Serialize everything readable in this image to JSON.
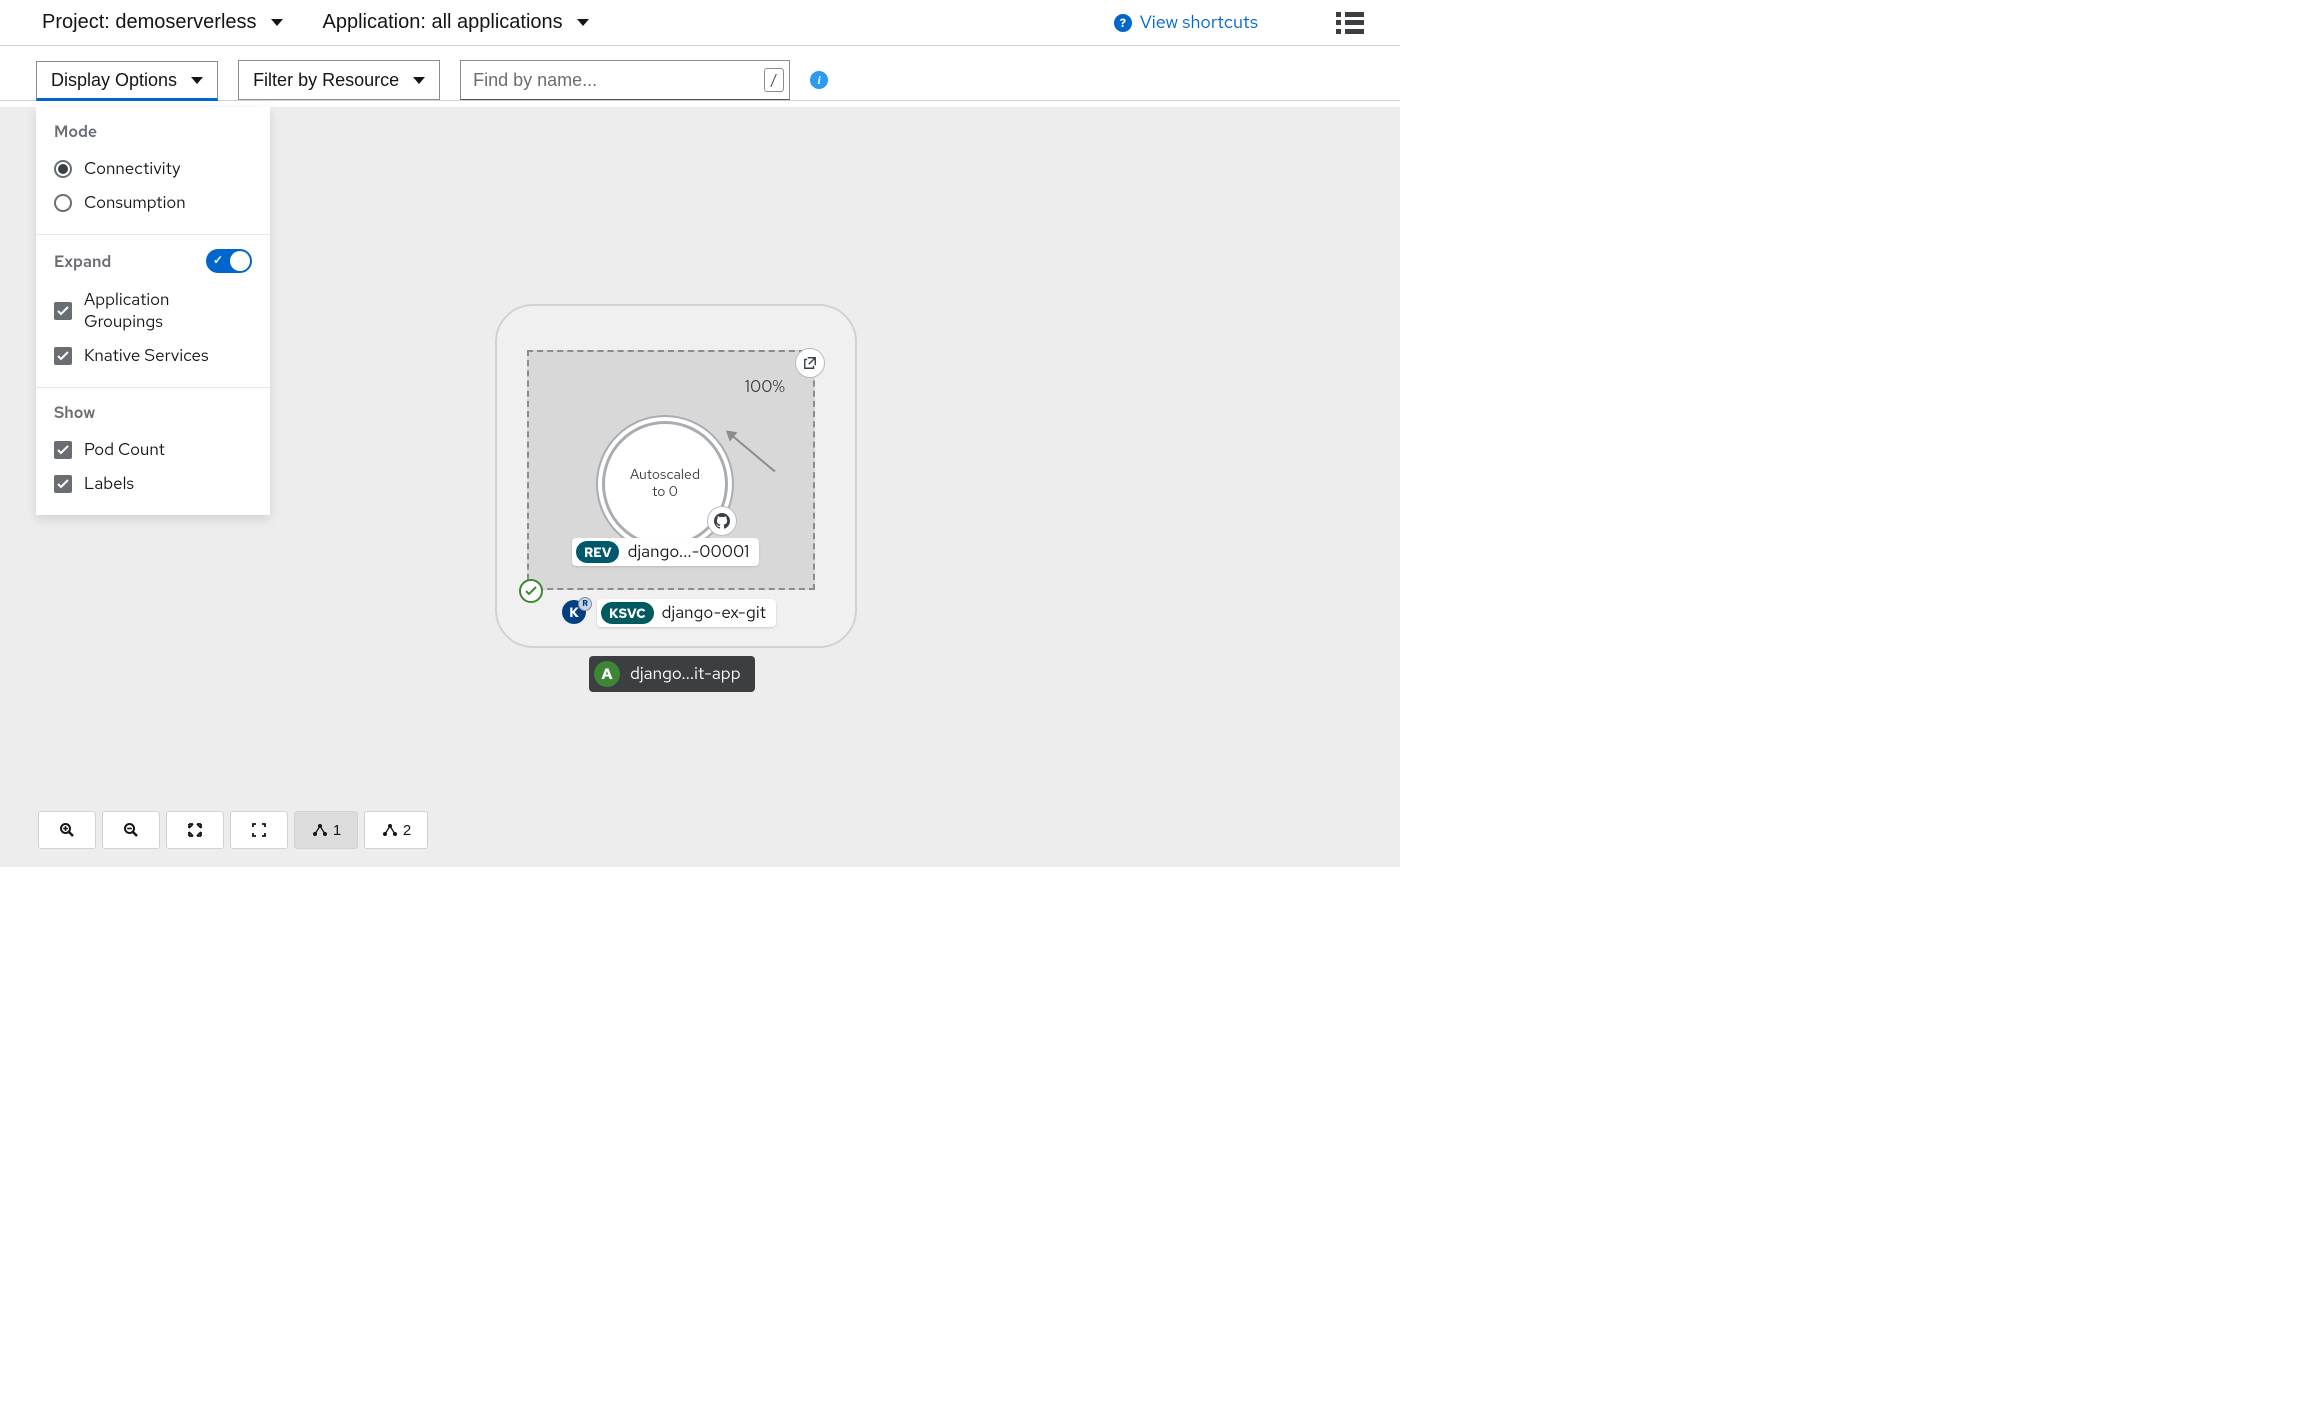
{
  "header": {
    "project_label": "Project: demoserverless",
    "application_label": "Application: all applications",
    "shortcuts_label": "View shortcuts"
  },
  "toolbar": {
    "display_options_label": "Display Options",
    "filter_label": "Filter by Resource",
    "search_placeholder": "Find by name...",
    "slash_hint": "/"
  },
  "panel": {
    "mode_title": "Mode",
    "mode_options": [
      "Connectivity",
      "Consumption"
    ],
    "mode_selected": "Connectivity",
    "expand_title": "Expand",
    "expand_options": [
      "Application Groupings",
      "Knative Services"
    ],
    "show_title": "Show",
    "show_options": [
      "Pod Count",
      "Labels"
    ]
  },
  "topology": {
    "traffic_pct": "100%",
    "donut_line1": "Autoscaled",
    "donut_line2": "to 0",
    "rev_badge": "REV",
    "rev_name": "django...-00001",
    "ksvc_badge": "KSVC",
    "ksvc_name": "django-ex-git",
    "app_badge": "A",
    "app_name": "django...it-app",
    "k_letter": "K",
    "r_letter": "R"
  },
  "bottom": {
    "layout1": "1",
    "layout2": "2"
  }
}
